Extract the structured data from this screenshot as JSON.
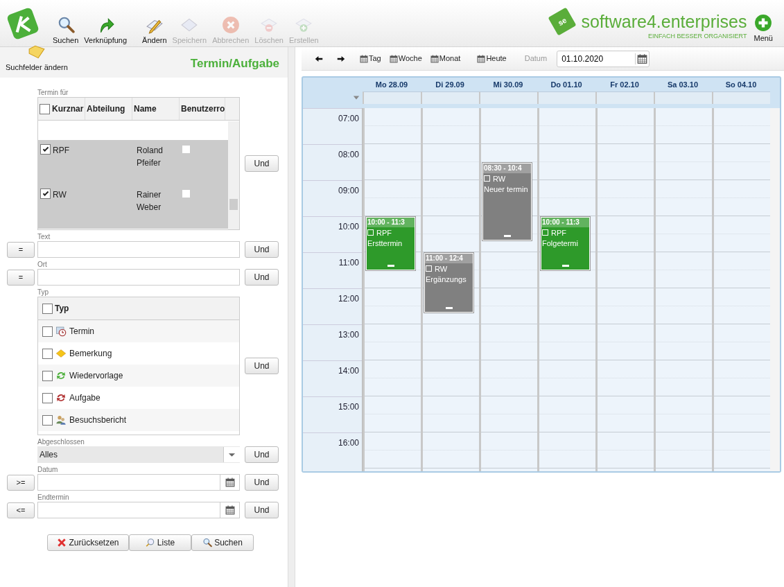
{
  "toolbar": {
    "items": [
      {
        "label": "Suchen",
        "kind": "search",
        "disabled": false
      },
      {
        "label": "Verknüpfung",
        "kind": "link",
        "disabled": false
      },
      {
        "label": "Ändern",
        "kind": "edit",
        "disabled": false
      },
      {
        "label": "Speichern",
        "kind": "save",
        "disabled": true
      },
      {
        "label": "Abbrechen",
        "kind": "cancel",
        "disabled": true
      },
      {
        "label": "Löschen",
        "kind": "delete",
        "disabled": true
      },
      {
        "label": "Erstellen",
        "kind": "create",
        "disabled": true
      }
    ],
    "brand": {
      "name": "software4.enterprises",
      "badge": "se",
      "tagline": "EINFACH BESSER ORGANISIERT"
    },
    "menu": "Menü"
  },
  "search_panel": {
    "change_fields": "Suchfelder ändern",
    "title": "Termin/Aufgabe",
    "termin_fuer": {
      "label": "Termin für",
      "all_checked": false,
      "columns": [
        "Kurznar",
        "Abteilung",
        "Name",
        "Benutzerro"
      ],
      "rows": [
        {
          "short": "RPF",
          "name": "Roland Pfeifer",
          "checked": true,
          "selected": true
        },
        {
          "short": "RW",
          "name": "Rainer Weber",
          "checked": true,
          "selected": true
        }
      ],
      "and": "Und"
    },
    "text": {
      "label": "Text",
      "op": "=",
      "and": "Und"
    },
    "ort": {
      "label": "Ort",
      "op": "=",
      "and": "Und"
    },
    "typ": {
      "label": "Typ",
      "header": "Typ",
      "all_checked": false,
      "items": [
        {
          "label": "Termin",
          "kind": "appointment",
          "checked": false
        },
        {
          "label": "Bemerkung",
          "kind": "note",
          "checked": false
        },
        {
          "label": "Wiedervorlage",
          "kind": "followup",
          "checked": false
        },
        {
          "label": "Aufgabe",
          "kind": "task",
          "checked": false
        },
        {
          "label": "Besuchsbericht",
          "kind": "visit",
          "checked": false
        }
      ],
      "and": "Und"
    },
    "abgeschlossen": {
      "label": "Abgeschlossen",
      "value": "Alles",
      "and": "Und"
    },
    "datum": {
      "label": "Datum",
      "op": ">=",
      "and": "Und"
    },
    "endtermin": {
      "label": "Endtermin",
      "op": "<=",
      "and": "Und"
    },
    "buttons": [
      {
        "label": "Zurücksetzen",
        "kind": "reset"
      },
      {
        "label": "Liste",
        "kind": "list"
      },
      {
        "label": "Suchen",
        "kind": "search"
      }
    ]
  },
  "calendar": {
    "nav": [
      {
        "label": "Tag"
      },
      {
        "label": "Woche"
      },
      {
        "label": "Monat"
      },
      {
        "label": "Heute"
      }
    ],
    "date_label": "Datum",
    "date": "01.10.2020",
    "hours": [
      "07:00",
      "08:00",
      "09:00",
      "10:00",
      "11:00",
      "12:00",
      "13:00",
      "14:00",
      "15:00",
      "16:00"
    ],
    "days": [
      {
        "label": "Mo 28.09",
        "events": [
          {
            "time": "10:00 - 11:3",
            "who": "RPF",
            "title": "Ersttermin",
            "color": "#2e9a2a"
          }
        ]
      },
      {
        "label": "Di 29.09",
        "events": [
          {
            "time": "11:00 - 12:4",
            "who": "RW",
            "title": "Ergänzungs",
            "color": "#808080"
          }
        ]
      },
      {
        "label": "Mi 30.09",
        "events": [
          {
            "time": "08:30 - 10:4",
            "who": "RW",
            "title": "Neuer termin",
            "color": "#808080"
          }
        ]
      },
      {
        "label": "Do 01.10",
        "events": [
          {
            "time": "10:00 - 11:3",
            "who": "RPF",
            "title": "Folgetermi",
            "color": "#2e9a2a"
          }
        ]
      },
      {
        "label": "Fr 02.10"
      },
      {
        "label": "Sa 03.10"
      },
      {
        "label": "So 04.10"
      }
    ]
  }
}
